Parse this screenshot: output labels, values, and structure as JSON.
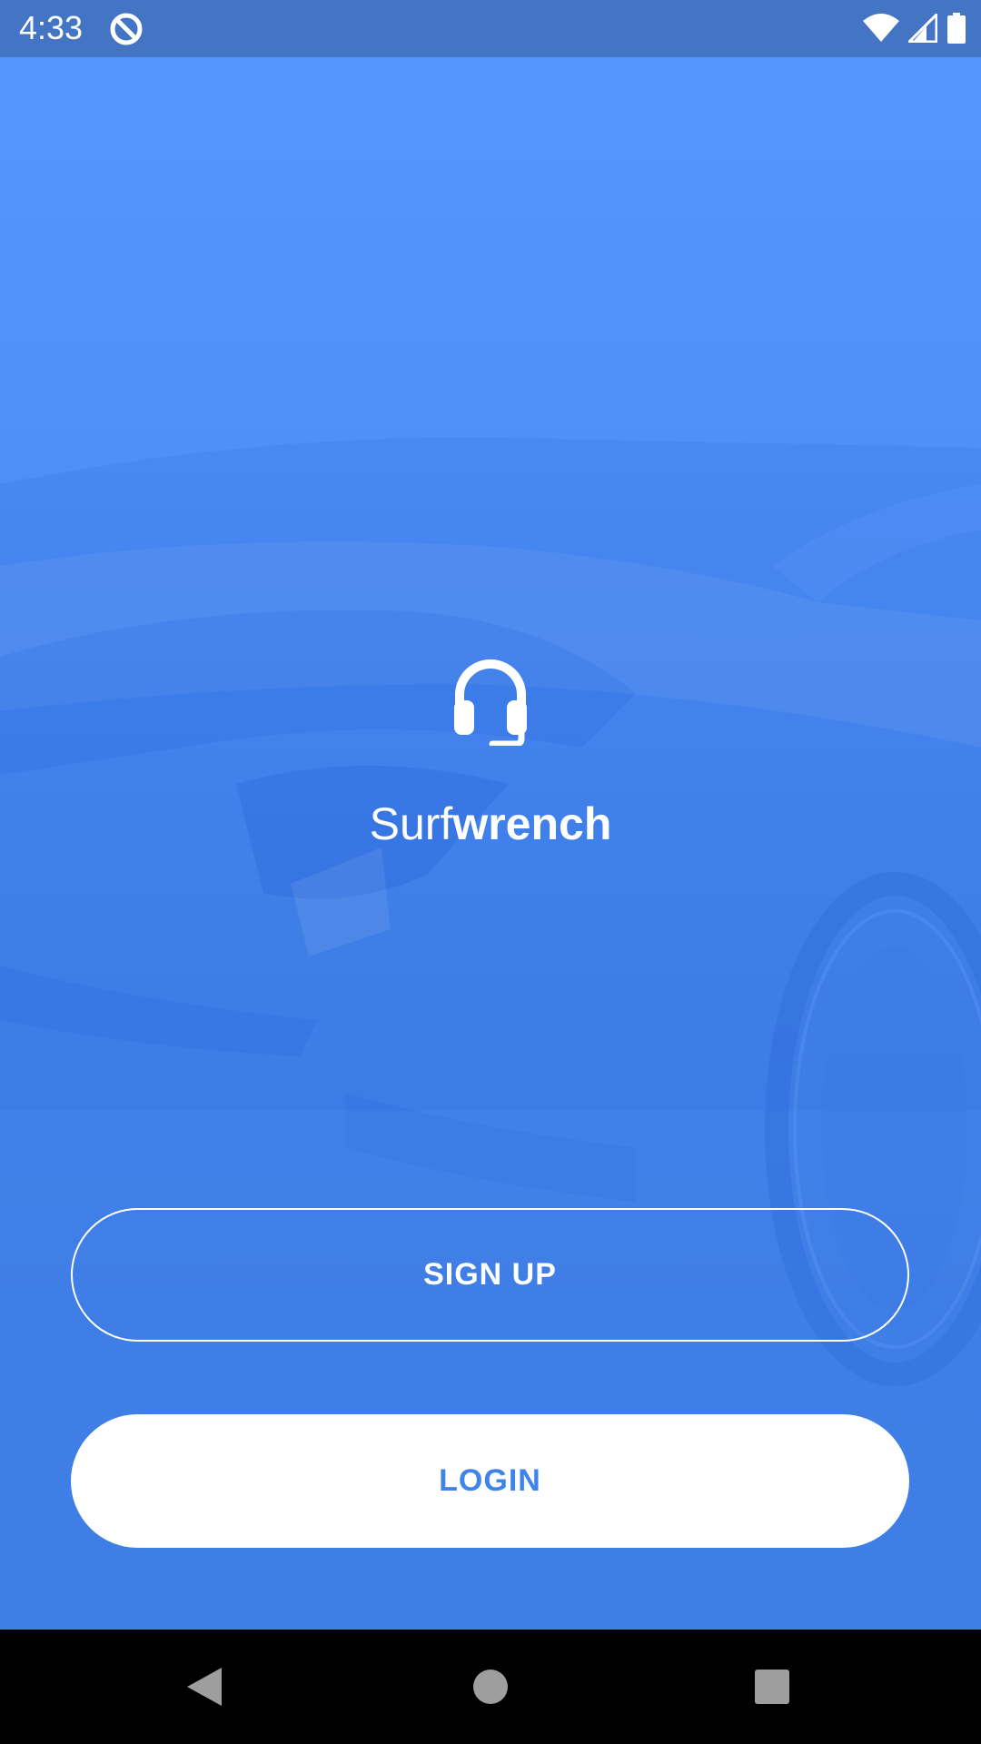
{
  "status_bar": {
    "time": "4:33",
    "icons": [
      "data-saver-icon",
      "wifi-icon",
      "cell-signal-icon",
      "battery-icon"
    ]
  },
  "brand": {
    "name_light": "Surf",
    "name_bold": "wrench",
    "logo_icon": "headset-icon"
  },
  "actions": {
    "signup_label": "SIGN UP",
    "login_label": "LOGIN"
  },
  "nav_bar": {
    "icons": [
      "back-icon",
      "home-icon",
      "recents-icon"
    ]
  },
  "colors": {
    "status_bar_bg": "#4474c4",
    "background_top": "#5595ff",
    "background_bottom": "#3f7ee4",
    "login_text": "#3f83ec",
    "white": "#ffffff"
  }
}
